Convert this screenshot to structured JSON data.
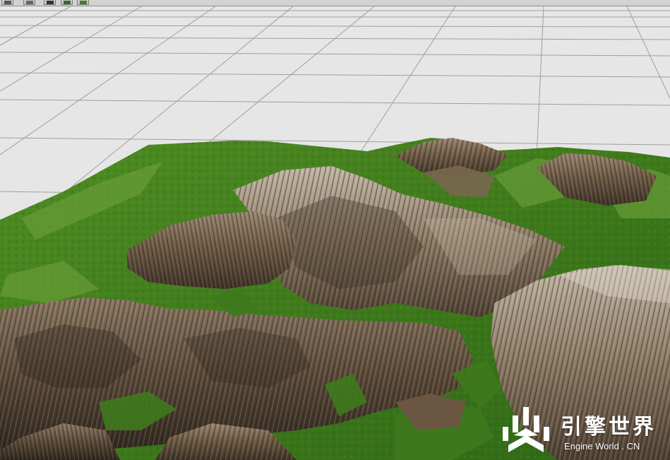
{
  "toolbar": {
    "buttons": [
      {
        "icon": "render-icon"
      },
      {
        "icon": "image-icon"
      },
      {
        "icon": "camera-icon"
      },
      {
        "icon": "terrain-icon"
      },
      {
        "icon": "landscape-icon"
      }
    ]
  },
  "viewport": {
    "content": "3d-terrain",
    "background": "#e6e6e6",
    "grid_line_color": "#9e9e9e",
    "vegetation_color": "#3f7a1c",
    "rock_color": "#6e5a44"
  },
  "watermark": {
    "title": "引擎世界",
    "subtitle": "Engine World . CN",
    "color": "#ffffff"
  }
}
